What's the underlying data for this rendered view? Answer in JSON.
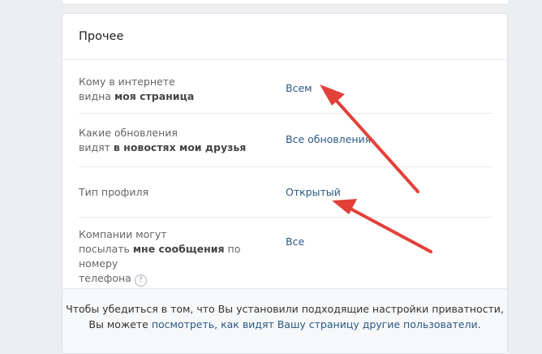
{
  "section": {
    "title": "Прочее"
  },
  "rows": [
    {
      "label_plain": "Кому в интернете",
      "label_prefix": "видна ",
      "label_bold": "моя страница",
      "value": "Всем"
    },
    {
      "label_plain": "Какие обновления",
      "label_prefix": "видят ",
      "label_bold": "в новостях мои друзья",
      "value": "Все обновления"
    },
    {
      "label_plain": "Тип профиля",
      "value": "Открытый"
    },
    {
      "label_plain": "Компании могут",
      "label_prefix": "посылать ",
      "label_bold": "мне сообщения",
      "label_suffix": " по номеру",
      "label_line3": "телефона",
      "help_glyph": "?",
      "value": "Все"
    }
  ],
  "footer": {
    "line1": "Чтобы убедиться в том, что Вы установили подходящие настройки приватности,",
    "line2_prefix": "Вы можете ",
    "link_text": "посмотреть, как видят Вашу страницу другие пользователи",
    "line2_suffix": "."
  },
  "colors": {
    "link": "#2a5885",
    "annotation_arrow": "#e3403a",
    "background": "#edeef0"
  },
  "icons": [
    "help-icon",
    "annotation-arrow"
  ]
}
